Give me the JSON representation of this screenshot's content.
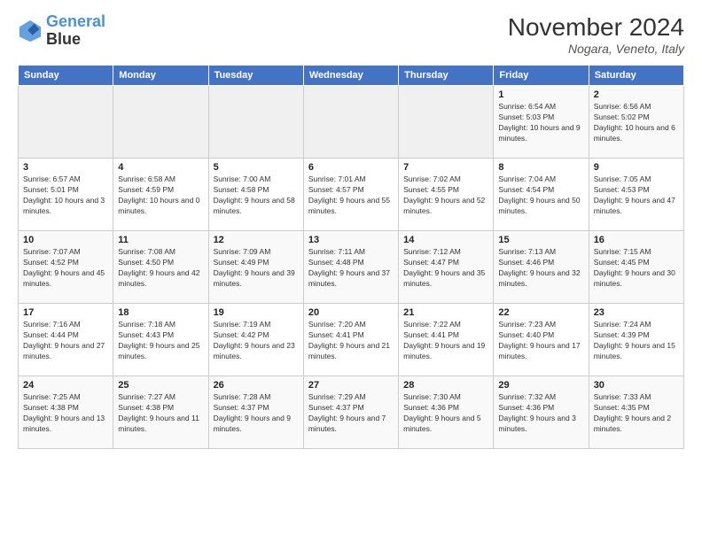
{
  "header": {
    "logo_line1": "General",
    "logo_line2": "Blue",
    "month_title": "November 2024",
    "location": "Nogara, Veneto, Italy"
  },
  "weekdays": [
    "Sunday",
    "Monday",
    "Tuesday",
    "Wednesday",
    "Thursday",
    "Friday",
    "Saturday"
  ],
  "weeks": [
    [
      {
        "day": "",
        "sunrise": "",
        "sunset": "",
        "daylight": ""
      },
      {
        "day": "",
        "sunrise": "",
        "sunset": "",
        "daylight": ""
      },
      {
        "day": "",
        "sunrise": "",
        "sunset": "",
        "daylight": ""
      },
      {
        "day": "",
        "sunrise": "",
        "sunset": "",
        "daylight": ""
      },
      {
        "day": "",
        "sunrise": "",
        "sunset": "",
        "daylight": ""
      },
      {
        "day": "1",
        "sunrise": "Sunrise: 6:54 AM",
        "sunset": "Sunset: 5:03 PM",
        "daylight": "Daylight: 10 hours and 9 minutes."
      },
      {
        "day": "2",
        "sunrise": "Sunrise: 6:56 AM",
        "sunset": "Sunset: 5:02 PM",
        "daylight": "Daylight: 10 hours and 6 minutes."
      }
    ],
    [
      {
        "day": "3",
        "sunrise": "Sunrise: 6:57 AM",
        "sunset": "Sunset: 5:01 PM",
        "daylight": "Daylight: 10 hours and 3 minutes."
      },
      {
        "day": "4",
        "sunrise": "Sunrise: 6:58 AM",
        "sunset": "Sunset: 4:59 PM",
        "daylight": "Daylight: 10 hours and 0 minutes."
      },
      {
        "day": "5",
        "sunrise": "Sunrise: 7:00 AM",
        "sunset": "Sunset: 4:58 PM",
        "daylight": "Daylight: 9 hours and 58 minutes."
      },
      {
        "day": "6",
        "sunrise": "Sunrise: 7:01 AM",
        "sunset": "Sunset: 4:57 PM",
        "daylight": "Daylight: 9 hours and 55 minutes."
      },
      {
        "day": "7",
        "sunrise": "Sunrise: 7:02 AM",
        "sunset": "Sunset: 4:55 PM",
        "daylight": "Daylight: 9 hours and 52 minutes."
      },
      {
        "day": "8",
        "sunrise": "Sunrise: 7:04 AM",
        "sunset": "Sunset: 4:54 PM",
        "daylight": "Daylight: 9 hours and 50 minutes."
      },
      {
        "day": "9",
        "sunrise": "Sunrise: 7:05 AM",
        "sunset": "Sunset: 4:53 PM",
        "daylight": "Daylight: 9 hours and 47 minutes."
      }
    ],
    [
      {
        "day": "10",
        "sunrise": "Sunrise: 7:07 AM",
        "sunset": "Sunset: 4:52 PM",
        "daylight": "Daylight: 9 hours and 45 minutes."
      },
      {
        "day": "11",
        "sunrise": "Sunrise: 7:08 AM",
        "sunset": "Sunset: 4:50 PM",
        "daylight": "Daylight: 9 hours and 42 minutes."
      },
      {
        "day": "12",
        "sunrise": "Sunrise: 7:09 AM",
        "sunset": "Sunset: 4:49 PM",
        "daylight": "Daylight: 9 hours and 39 minutes."
      },
      {
        "day": "13",
        "sunrise": "Sunrise: 7:11 AM",
        "sunset": "Sunset: 4:48 PM",
        "daylight": "Daylight: 9 hours and 37 minutes."
      },
      {
        "day": "14",
        "sunrise": "Sunrise: 7:12 AM",
        "sunset": "Sunset: 4:47 PM",
        "daylight": "Daylight: 9 hours and 35 minutes."
      },
      {
        "day": "15",
        "sunrise": "Sunrise: 7:13 AM",
        "sunset": "Sunset: 4:46 PM",
        "daylight": "Daylight: 9 hours and 32 minutes."
      },
      {
        "day": "16",
        "sunrise": "Sunrise: 7:15 AM",
        "sunset": "Sunset: 4:45 PM",
        "daylight": "Daylight: 9 hours and 30 minutes."
      }
    ],
    [
      {
        "day": "17",
        "sunrise": "Sunrise: 7:16 AM",
        "sunset": "Sunset: 4:44 PM",
        "daylight": "Daylight: 9 hours and 27 minutes."
      },
      {
        "day": "18",
        "sunrise": "Sunrise: 7:18 AM",
        "sunset": "Sunset: 4:43 PM",
        "daylight": "Daylight: 9 hours and 25 minutes."
      },
      {
        "day": "19",
        "sunrise": "Sunrise: 7:19 AM",
        "sunset": "Sunset: 4:42 PM",
        "daylight": "Daylight: 9 hours and 23 minutes."
      },
      {
        "day": "20",
        "sunrise": "Sunrise: 7:20 AM",
        "sunset": "Sunset: 4:41 PM",
        "daylight": "Daylight: 9 hours and 21 minutes."
      },
      {
        "day": "21",
        "sunrise": "Sunrise: 7:22 AM",
        "sunset": "Sunset: 4:41 PM",
        "daylight": "Daylight: 9 hours and 19 minutes."
      },
      {
        "day": "22",
        "sunrise": "Sunrise: 7:23 AM",
        "sunset": "Sunset: 4:40 PM",
        "daylight": "Daylight: 9 hours and 17 minutes."
      },
      {
        "day": "23",
        "sunrise": "Sunrise: 7:24 AM",
        "sunset": "Sunset: 4:39 PM",
        "daylight": "Daylight: 9 hours and 15 minutes."
      }
    ],
    [
      {
        "day": "24",
        "sunrise": "Sunrise: 7:25 AM",
        "sunset": "Sunset: 4:38 PM",
        "daylight": "Daylight: 9 hours and 13 minutes."
      },
      {
        "day": "25",
        "sunrise": "Sunrise: 7:27 AM",
        "sunset": "Sunset: 4:38 PM",
        "daylight": "Daylight: 9 hours and 11 minutes."
      },
      {
        "day": "26",
        "sunrise": "Sunrise: 7:28 AM",
        "sunset": "Sunset: 4:37 PM",
        "daylight": "Daylight: 9 hours and 9 minutes."
      },
      {
        "day": "27",
        "sunrise": "Sunrise: 7:29 AM",
        "sunset": "Sunset: 4:37 PM",
        "daylight": "Daylight: 9 hours and 7 minutes."
      },
      {
        "day": "28",
        "sunrise": "Sunrise: 7:30 AM",
        "sunset": "Sunset: 4:36 PM",
        "daylight": "Daylight: 9 hours and 5 minutes."
      },
      {
        "day": "29",
        "sunrise": "Sunrise: 7:32 AM",
        "sunset": "Sunset: 4:36 PM",
        "daylight": "Daylight: 9 hours and 3 minutes."
      },
      {
        "day": "30",
        "sunrise": "Sunrise: 7:33 AM",
        "sunset": "Sunset: 4:35 PM",
        "daylight": "Daylight: 9 hours and 2 minutes."
      }
    ]
  ]
}
